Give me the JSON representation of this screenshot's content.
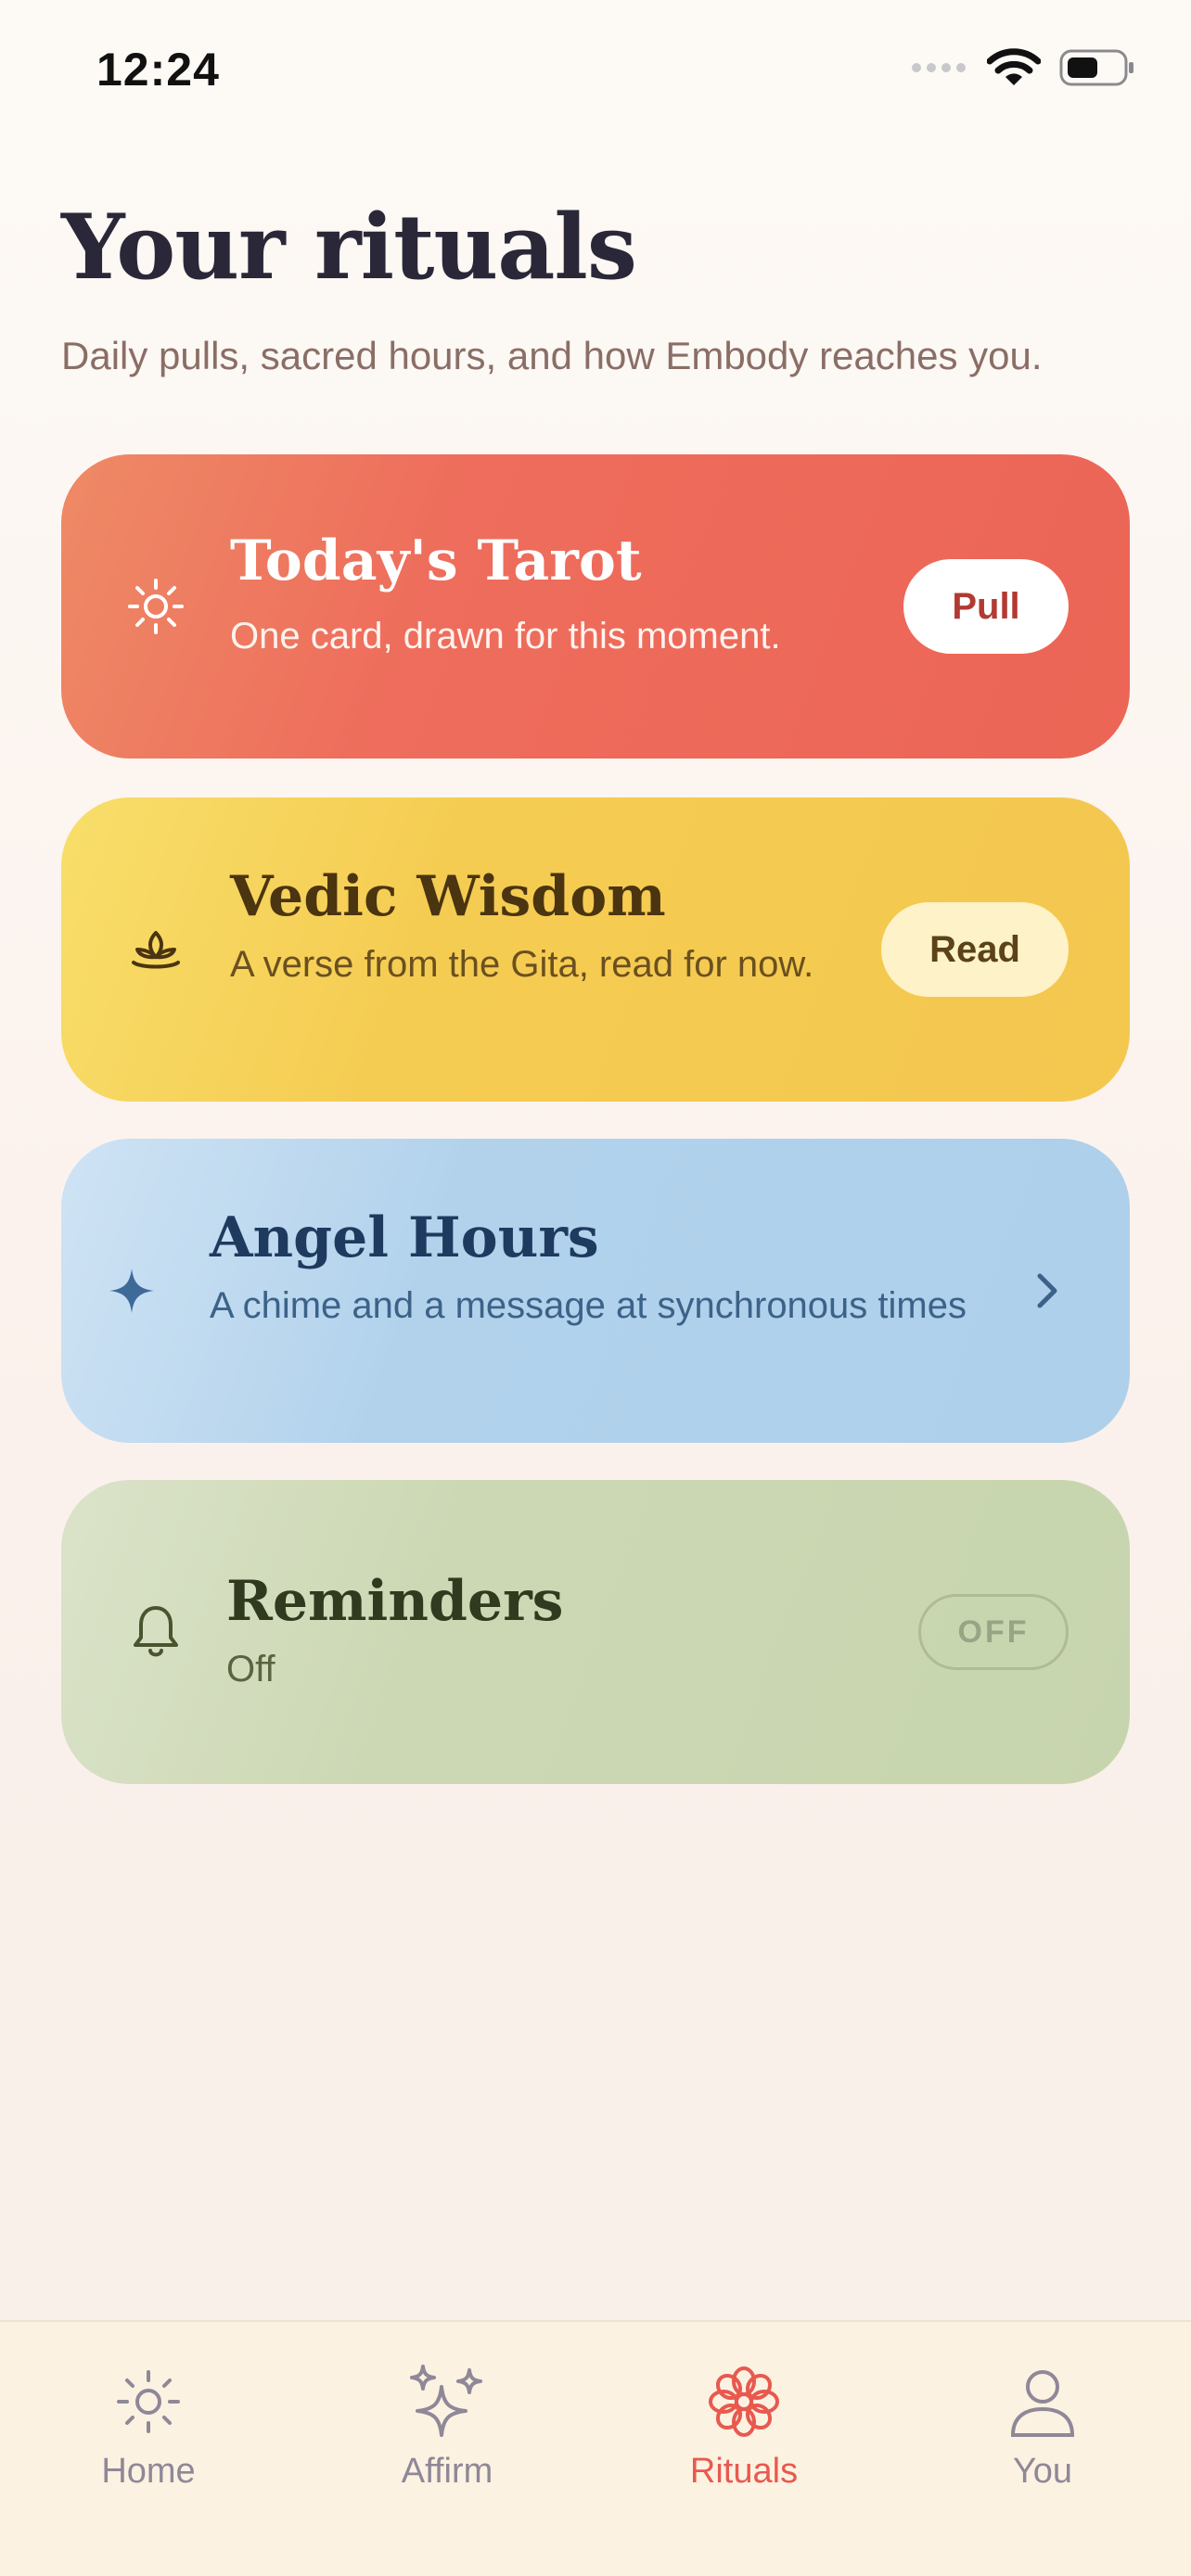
{
  "status_bar": {
    "time": "12:24"
  },
  "header": {
    "title": "Your rituals",
    "subtitle": "Daily pulls, sacred hours, and how Embody reaches you."
  },
  "cards": {
    "tarot": {
      "icon": "sun-icon",
      "title": "Today's Tarot",
      "description": "One card, drawn for this moment.",
      "button_label": "Pull",
      "color": "#ee6d5c"
    },
    "vedic": {
      "icon": "lotus-icon",
      "title": "Vedic Wisdom",
      "description": "A verse from the Gita, read for now.",
      "button_label": "Read",
      "color": "#f5cc52"
    },
    "angel": {
      "icon": "sparkle-icon",
      "title": "Angel Hours",
      "description": "A chime and a message at synchronous times",
      "action_icon": "chevron-right-icon",
      "color": "#b2d2ec"
    },
    "reminders": {
      "icon": "bell-icon",
      "title": "Reminders",
      "description": "Off",
      "toggle_label": "OFF",
      "color": "#ccd8b4"
    }
  },
  "tab_bar": {
    "tabs": [
      {
        "label": "Home",
        "icon": "sun-icon",
        "active": false
      },
      {
        "label": "Affirm",
        "icon": "sparkles-icon",
        "active": false
      },
      {
        "label": "Rituals",
        "icon": "flower-icon",
        "active": true
      },
      {
        "label": "You",
        "icon": "person-icon",
        "active": false
      }
    ],
    "active_color": "#e8594f",
    "inactive_color": "#8e8898"
  }
}
